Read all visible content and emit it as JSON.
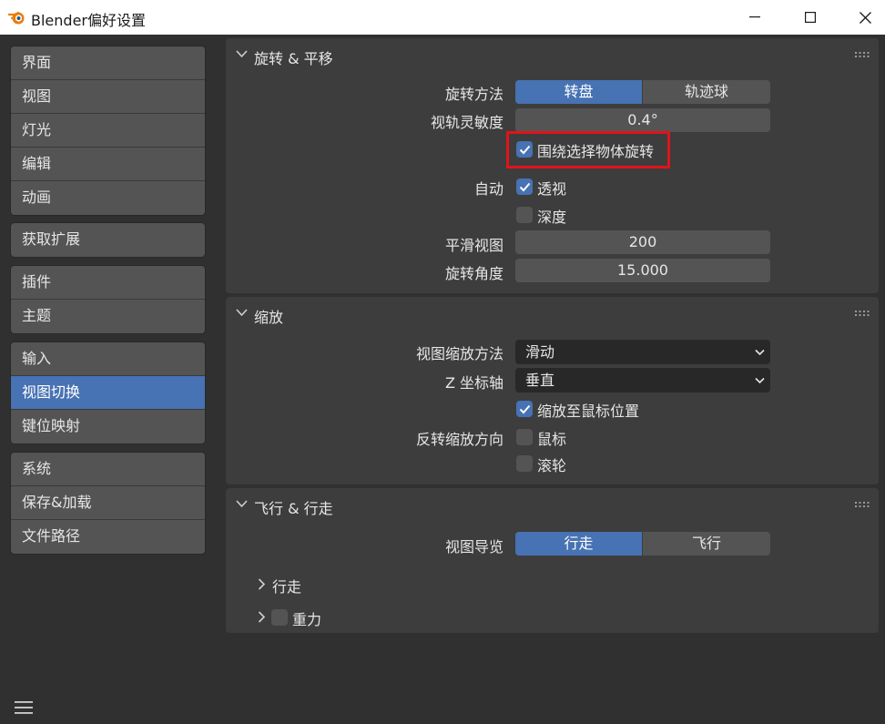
{
  "window": {
    "title": "Blender偏好设置",
    "icons": {
      "app": "blender-icon",
      "minimize": "minimize-icon",
      "maximize": "maximize-icon",
      "close": "close-icon"
    }
  },
  "sidebar": {
    "groups": [
      {
        "items": [
          "界面",
          "视图",
          "灯光",
          "编辑",
          "动画"
        ]
      },
      {
        "items": [
          "获取扩展"
        ]
      },
      {
        "items": [
          "插件",
          "主题"
        ]
      },
      {
        "items": [
          "输入",
          "视图切换",
          "键位映射"
        ]
      },
      {
        "items": [
          "系统",
          "保存&加载",
          "文件路径"
        ]
      }
    ],
    "active_item": "视图切换"
  },
  "panels": {
    "rotate_pan": {
      "title": "旋转 & 平移",
      "rotate_method_label": "旋转方法",
      "rotate_method_options": [
        "转盘",
        "轨迹球"
      ],
      "rotate_method_selected": "转盘",
      "orbit_sensitivity_label": "视轨灵敏度",
      "orbit_sensitivity_value": "0.4°",
      "orbit_around_selection_label": "围绕选择物体旋转",
      "orbit_around_selection_checked": true,
      "auto_label": "自动",
      "auto_perspective_label": "透视",
      "auto_perspective_checked": true,
      "auto_depth_label": "深度",
      "auto_depth_checked": false,
      "smooth_view_label": "平滑视图",
      "smooth_view_value": "200",
      "rotation_angle_label": "旋转角度",
      "rotation_angle_value": "15.000"
    },
    "zoom": {
      "title": "缩放",
      "zoom_method_label": "视图缩放方法",
      "zoom_method_value": "滑动",
      "z_axis_label": "Z 坐标轴",
      "z_axis_value": "垂直",
      "zoom_to_mouse_label": "缩放至鼠标位置",
      "zoom_to_mouse_checked": true,
      "invert_label": "反转缩放方向",
      "invert_mouse_label": "鼠标",
      "invert_mouse_checked": false,
      "invert_wheel_label": "滚轮",
      "invert_wheel_checked": false
    },
    "fly_walk": {
      "title": "飞行 & 行走",
      "view_nav_label": "视图导览",
      "view_nav_options": [
        "行走",
        "飞行"
      ],
      "view_nav_selected": "行走",
      "walk_subpanel": "行走",
      "gravity_subpanel": "重力",
      "gravity_checked": false
    }
  },
  "colors": {
    "accent": "#4772b3",
    "highlight_box": "#e0141a",
    "panel_bg": "#3d3d3d",
    "window_bg": "#303030"
  }
}
